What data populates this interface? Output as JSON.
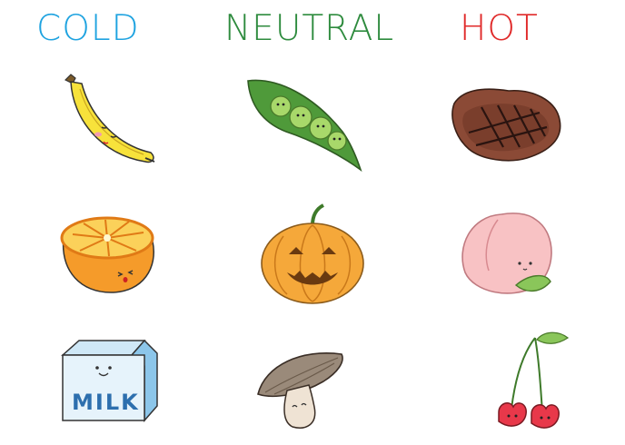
{
  "columns": [
    {
      "label": "COLD",
      "color": "#1fa3e0"
    },
    {
      "label": "NEUTRAL",
      "color": "#2e8b3e"
    },
    {
      "label": "HOT",
      "color": "#e02a2a"
    }
  ],
  "items": {
    "cold": [
      "banana-icon",
      "orange-icon",
      "milk-carton-icon"
    ],
    "neutral": [
      "peas-icon",
      "pumpkin-icon",
      "mushroom-icon"
    ],
    "hot": [
      "steak-icon",
      "peach-icon",
      "cherries-icon"
    ]
  },
  "milk_label": "MILK"
}
